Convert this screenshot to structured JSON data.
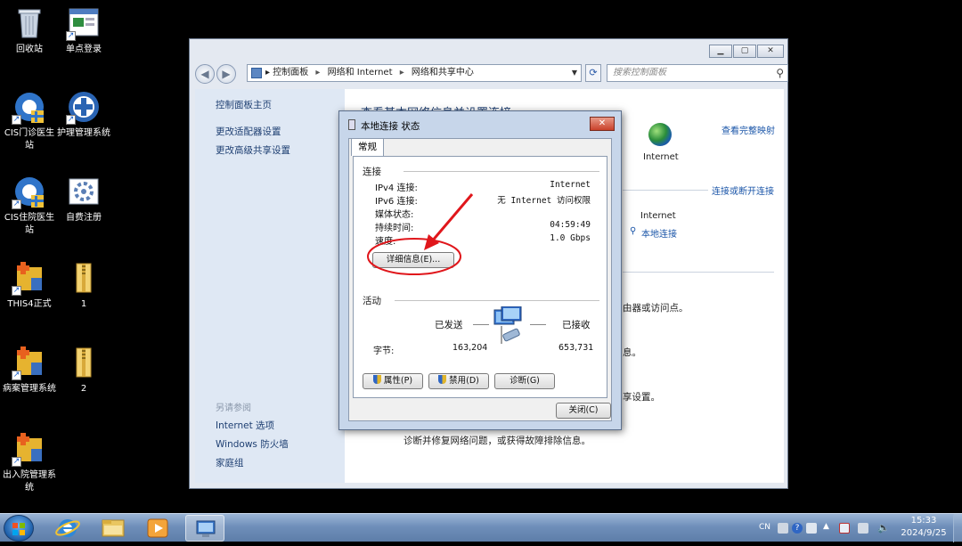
{
  "desktop": {
    "icons": [
      {
        "label": "回收站",
        "icon": "recycle-bin-icon"
      },
      {
        "label": "单点登录",
        "icon": "single-sign-on-icon"
      },
      {
        "label": "CIS门诊医生站",
        "icon": "cis-outpatient-icon"
      },
      {
        "label": "护理管理系统",
        "icon": "nursing-system-icon"
      },
      {
        "label": "CIS住院医生站",
        "icon": "cis-inpatient-icon"
      },
      {
        "label": "自费注册",
        "icon": "self-pay-register-icon"
      },
      {
        "label": "THIS4正式",
        "icon": "this4-icon"
      },
      {
        "label": "1",
        "icon": "zip-folder-icon"
      },
      {
        "label": "病案管理系统",
        "icon": "medical-records-icon"
      },
      {
        "label": "2",
        "icon": "zip-folder-icon"
      },
      {
        "label": "出入院管理系统",
        "icon": "admission-discharge-icon"
      }
    ]
  },
  "explorer": {
    "breadcrumb": [
      "控制面板",
      "网络和 Internet",
      "网络和共享中心"
    ],
    "search_placeholder": "搜索控制面板",
    "left_pane": {
      "links": [
        "控制面板主页",
        "更改适配器设置",
        "更改高级共享设置"
      ],
      "see_also_heading": "另请参阅",
      "see_also": [
        "Internet 选项",
        "Windows 防火墙",
        "家庭组"
      ]
    },
    "main": {
      "title": "查看基本网络信息并设置连接",
      "full_map_link": "查看完整映射",
      "internet_label": "Internet",
      "connect_disconnect_link": "连接或断开连接",
      "access_type": "Internet",
      "connection_link": "本地连接",
      "frag_access_point": "由器或访问点。",
      "frag_line2": "息。",
      "frag_settings": "享设置。",
      "troubleshoot": "诊断并修复网络问题，或获得故障排除信息。"
    }
  },
  "dialog": {
    "title": "本地连接 状态",
    "close_glyph": "✕",
    "tab": "常规",
    "connection_group": "连接",
    "rows": [
      {
        "label": "IPv4 连接:",
        "value": "Internet"
      },
      {
        "label": "IPv6 连接:",
        "value": "无 Internet 访问权限"
      },
      {
        "label": "媒体状态:",
        "value": ""
      },
      {
        "label": "持续时间:",
        "value": "04:59:49"
      },
      {
        "label": "速度:",
        "value": "1.0 Gbps"
      }
    ],
    "details_button": "详细信息(E)...",
    "activity_group": "活动",
    "sent_label": "已发送",
    "received_label": "已接收",
    "bytes_label": "字节:",
    "bytes_sent": "163,204",
    "bytes_received": "653,731",
    "properties_button": "属性(P)",
    "disable_button": "禁用(D)",
    "diagnose_button": "诊断(G)",
    "close_button": "关闭(C)"
  },
  "taskbar": {
    "lang": "CN",
    "time": "15:33",
    "date": "2024/9/25",
    "pinned": [
      "ie-icon",
      "explorer-folder-icon",
      "media-player-icon",
      "network-control-icon"
    ]
  },
  "colors": {
    "annotation": "#e0161b",
    "link": "#1a55a8",
    "dialog_frame": "#c7d6ea"
  }
}
